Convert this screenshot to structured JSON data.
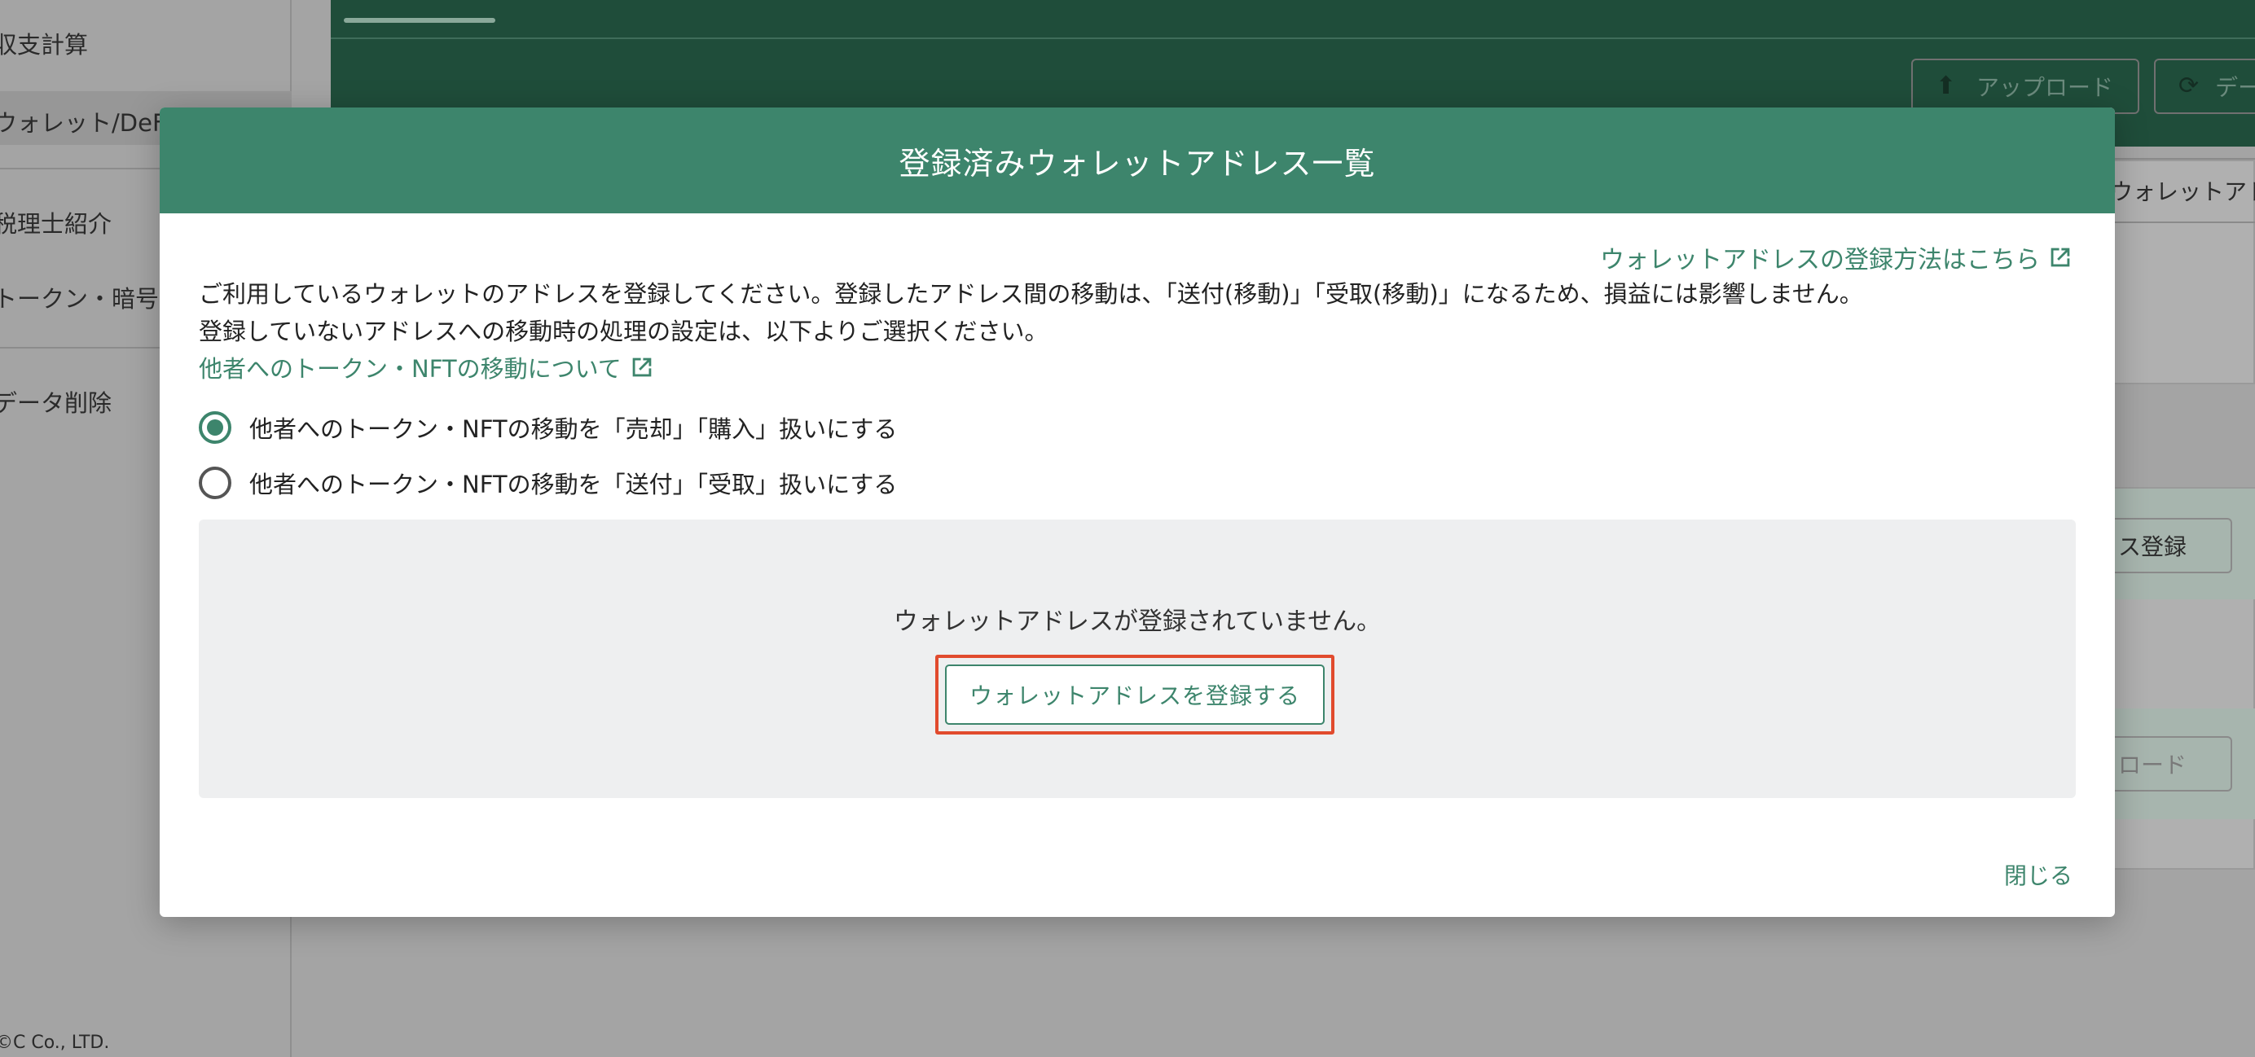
{
  "background": {
    "sidebar": {
      "items": [
        "収支計算",
        "ウォレット/DeFi取引",
        "税理士紹介",
        "トークン・暗号資産",
        "データ削除"
      ],
      "footer": "©C Co., LTD."
    },
    "toolbar": {
      "upload_label": "アップロード",
      "data_label": "データ管理"
    },
    "fields": {
      "wallet_address_fragment": "ウォレットアドレス",
      "register_fragment": "ス登録",
      "download_fragment": "ロード"
    }
  },
  "modal": {
    "title": "登録済みウォレットアドレス一覧",
    "help_link": "ウォレットアドレスの登録方法はこちら",
    "description_line1": "ご利用しているウォレットのアドレスを登録してください。登録したアドレス間の移動は、「送付(移動)」「受取(移動)」になるため、損益には影響しません。",
    "description_line2": "登録していないアドレスへの移動時の処理の設定は、以下よりご選択ください。",
    "transfer_link": "他者へのトークン・NFTの移動について",
    "options": [
      {
        "label": "他者へのトークン・NFTの移動を「売却」「購入」扱いにする",
        "checked": true
      },
      {
        "label": "他者へのトークン・NFTの移動を「送付」「受取」扱いにする",
        "checked": false
      }
    ],
    "empty_message": "ウォレットアドレスが登録されていません。",
    "register_button": "ウォレットアドレスを登録する",
    "close_label": "閉じる"
  },
  "colors": {
    "primary": "#3d856c",
    "highlight": "#e14b2e"
  }
}
